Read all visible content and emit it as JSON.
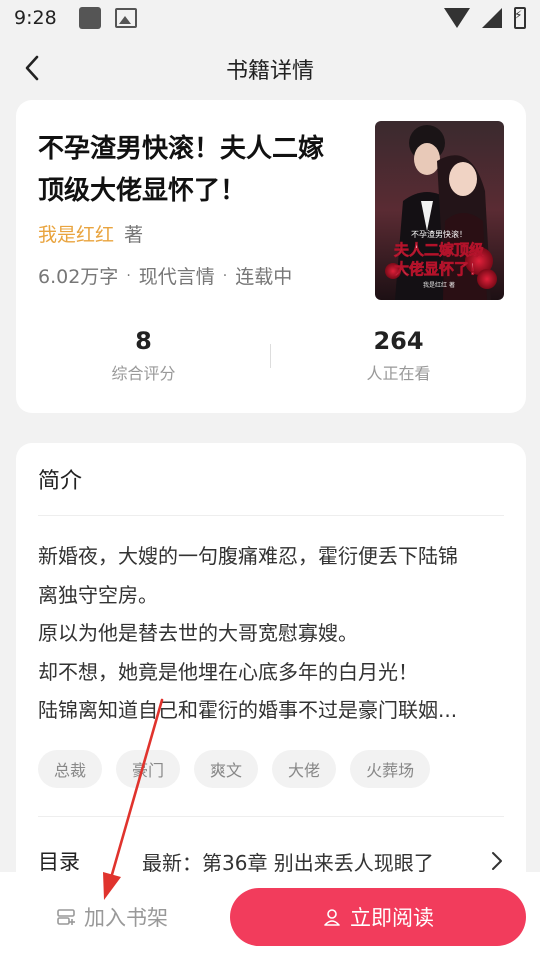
{
  "status_bar": {
    "time": "9:28"
  },
  "header": {
    "title": "书籍详情"
  },
  "book": {
    "title": "不孕渣男快滚！夫人二嫁顶级大佬显怀了！",
    "author": "我是红红",
    "author_suffix": "著",
    "word_count": "6.02万字",
    "category": "现代言情",
    "status": "连载中",
    "cover_text_small": "不孕渣男快滚！",
    "cover_text_line1": "夫人二嫁顶级",
    "cover_text_line2": "大佬显怀了！",
    "cover_credit": "我是红红 著"
  },
  "stats": [
    {
      "value": "8",
      "label": "综合评分"
    },
    {
      "value": "264",
      "label": "人正在看"
    }
  ],
  "intro": {
    "heading": "简介",
    "lines": [
      "新婚夜，大嫂的一句腹痛难忍，霍衍便丢下陆锦",
      "离独守空房。",
      "原以为他是替去世的大哥宽慰寡嫂。",
      "却不想，她竟是他埋在心底多年的白月光！",
      "陆锦离知道自己和霍衍的婚事不过是豪门联姻..."
    ],
    "tags": [
      "总裁",
      "豪门",
      "爽文",
      "大佬",
      "火葬场"
    ]
  },
  "toc": {
    "label": "目录",
    "latest": "最新：第36章 别出来丢人现眼了"
  },
  "bottom": {
    "shelf_label": "加入书架",
    "read_label": "立即阅读"
  },
  "icons": {
    "back": "chevron-left-icon",
    "chevron": "chevron-right-icon",
    "shelf": "bookshelf-icon",
    "read": "user-icon"
  },
  "colors": {
    "accent": "#f23c5c",
    "author": "#e9a43f",
    "annotation": "#e0332d",
    "background": "#f2f2f2"
  }
}
